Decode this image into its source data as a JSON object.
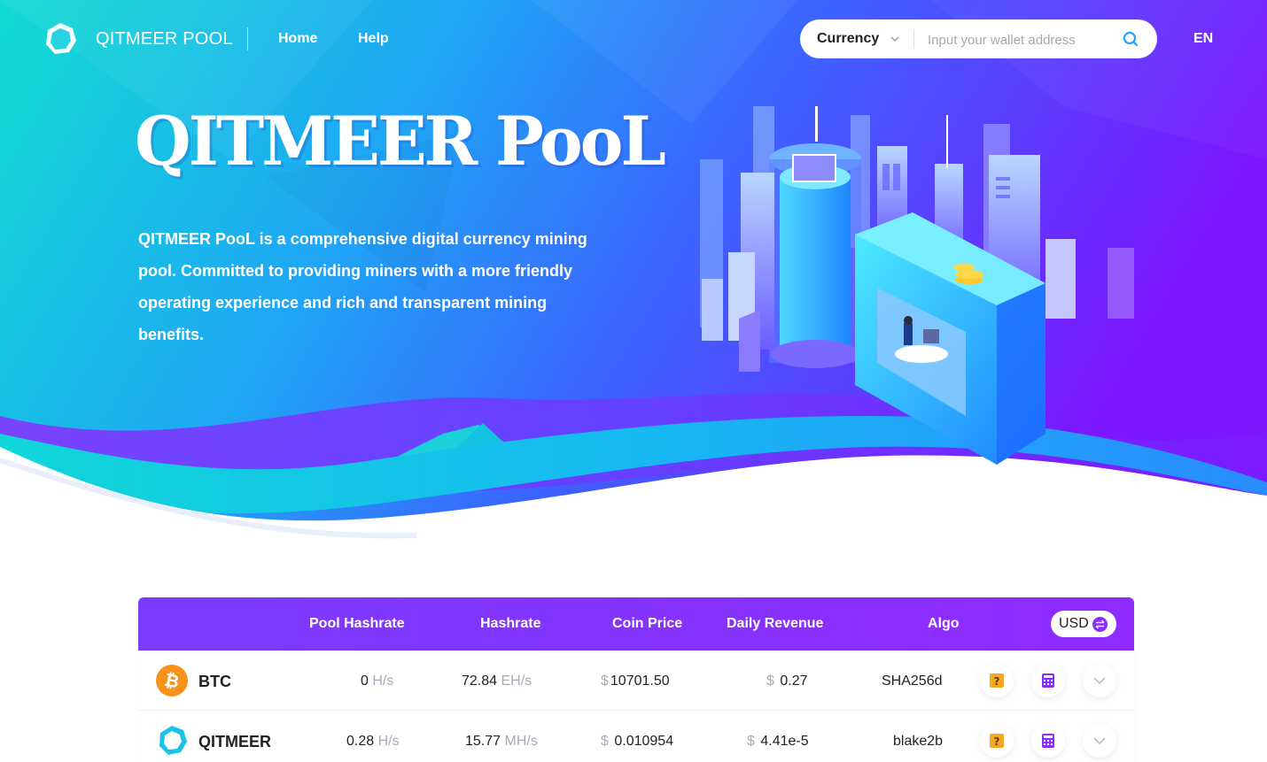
{
  "nav": {
    "logo_text": "QITMEER POOL",
    "links": [
      {
        "label": "Home"
      },
      {
        "label": "Help"
      }
    ],
    "currency_label": "Currency",
    "search_placeholder": "Input your wallet address",
    "language": "EN"
  },
  "hero": {
    "title": "QITMEER PooL",
    "description": "QITMEER PooL is a comprehensive digital currency mining pool. Committed to providing miners with a more friendly operating experience and rich and transparent mining benefits."
  },
  "table": {
    "headers": {
      "pool_hashrate": "Pool Hashrate",
      "hashrate": "Hashrate",
      "coin_price": "Coin Price",
      "daily_revenue": "Daily Revenue",
      "algo": "Algo"
    },
    "currency_toggle": "USD",
    "rows": [
      {
        "coin": "BTC",
        "pool_hashrate_value": "0",
        "pool_hashrate_unit": "H/s",
        "hashrate_value": "72.84",
        "hashrate_unit": "EH/s",
        "price_symbol": "$",
        "price": "10701.50",
        "revenue_symbol": "$",
        "revenue": "0.27",
        "algo": "SHA256d"
      },
      {
        "coin": "QITMEER",
        "pool_hashrate_value": "0.28",
        "pool_hashrate_unit": "H/s",
        "hashrate_value": "15.77",
        "hashrate_unit": "MH/s",
        "price_symbol": "$",
        "price": "0.010954",
        "revenue_symbol": "$",
        "revenue": "4.41e-5",
        "algo": "blake2b"
      }
    ]
  },
  "colors": {
    "hero_gradient_start": "#13d9d9",
    "hero_gradient_mid": "#2f7dff",
    "hero_gradient_end": "#7a1cff",
    "table_header": "#8a2dff",
    "btc_orange": "#f7931a",
    "help_icon_orange": "#f5a623",
    "calculator_purple": "#8a2dff"
  },
  "icons": {
    "logo": "hexagon-logo-icon",
    "currency_chevron": "chevron-down-icon",
    "search": "search-icon",
    "swap": "swap-icon",
    "btc": "bitcoin-icon",
    "qitmeer": "qitmeer-icon",
    "help": "question-icon",
    "calculator": "calculator-icon",
    "expand": "chevron-down-icon"
  }
}
